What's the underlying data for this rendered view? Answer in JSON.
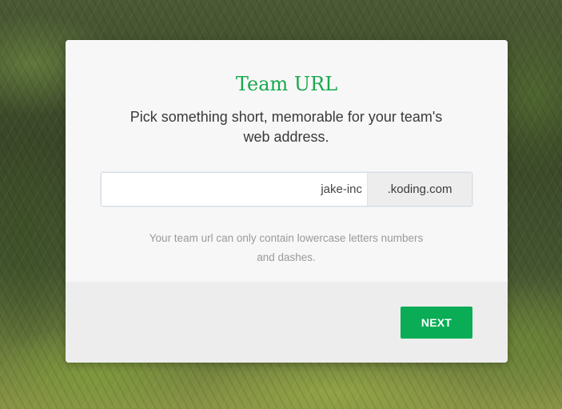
{
  "modal": {
    "title": "Team URL",
    "subtitle": "Pick something short, memorable for your team's web address.",
    "url_input": {
      "value": "jake-inc",
      "suffix": ".koding.com"
    },
    "hint": "Your team url can only contain lowercase letters numbers and dashes.",
    "next_label": "NEXT"
  },
  "colors": {
    "accent": "#1aa84e",
    "button": "#0aad55",
    "footer_bg": "#ededed",
    "body_bg": "#f7f7f7"
  }
}
